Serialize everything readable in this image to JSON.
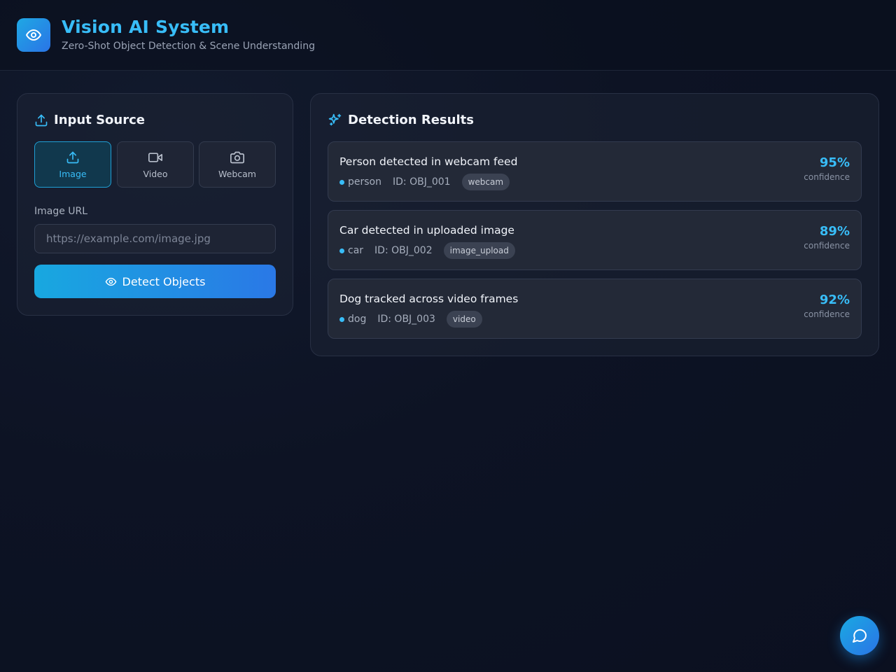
{
  "header": {
    "title": "Vision AI System",
    "subtitle": "Zero-Shot Object Detection & Scene Understanding",
    "logo_icon": "eye-icon"
  },
  "input_panel": {
    "title": "Input Source",
    "title_icon": "upload-icon",
    "sources": [
      {
        "label": "Image",
        "icon": "upload-icon",
        "active": true
      },
      {
        "label": "Video",
        "icon": "video-camera-icon",
        "active": false
      },
      {
        "label": "Webcam",
        "icon": "camera-icon",
        "active": false
      }
    ],
    "url_label": "Image URL",
    "url_placeholder": "https://example.com/image.jpg",
    "url_value": "",
    "detect_button": "Detect Objects"
  },
  "results_panel": {
    "title": "Detection Results",
    "title_icon": "sparkles-icon",
    "results": [
      {
        "title": "Person detected in webcam feed",
        "label": "person",
        "id": "ID: OBJ_001",
        "source": "webcam",
        "confidence": "95%",
        "confidence_label": "confidence"
      },
      {
        "title": "Car detected in uploaded image",
        "label": "car",
        "id": "ID: OBJ_002",
        "source": "image_upload",
        "confidence": "89%",
        "confidence_label": "confidence"
      },
      {
        "title": "Dog tracked across video frames",
        "label": "dog",
        "id": "ID: OBJ_003",
        "source": "video",
        "confidence": "92%",
        "confidence_label": "confidence"
      }
    ]
  },
  "colors": {
    "accent": "#38bdf8",
    "gradient_start": "#18a8e0",
    "gradient_end": "#2a78e6",
    "background": "#0d1324"
  },
  "chat_button_icon": "chat-bubble-icon"
}
